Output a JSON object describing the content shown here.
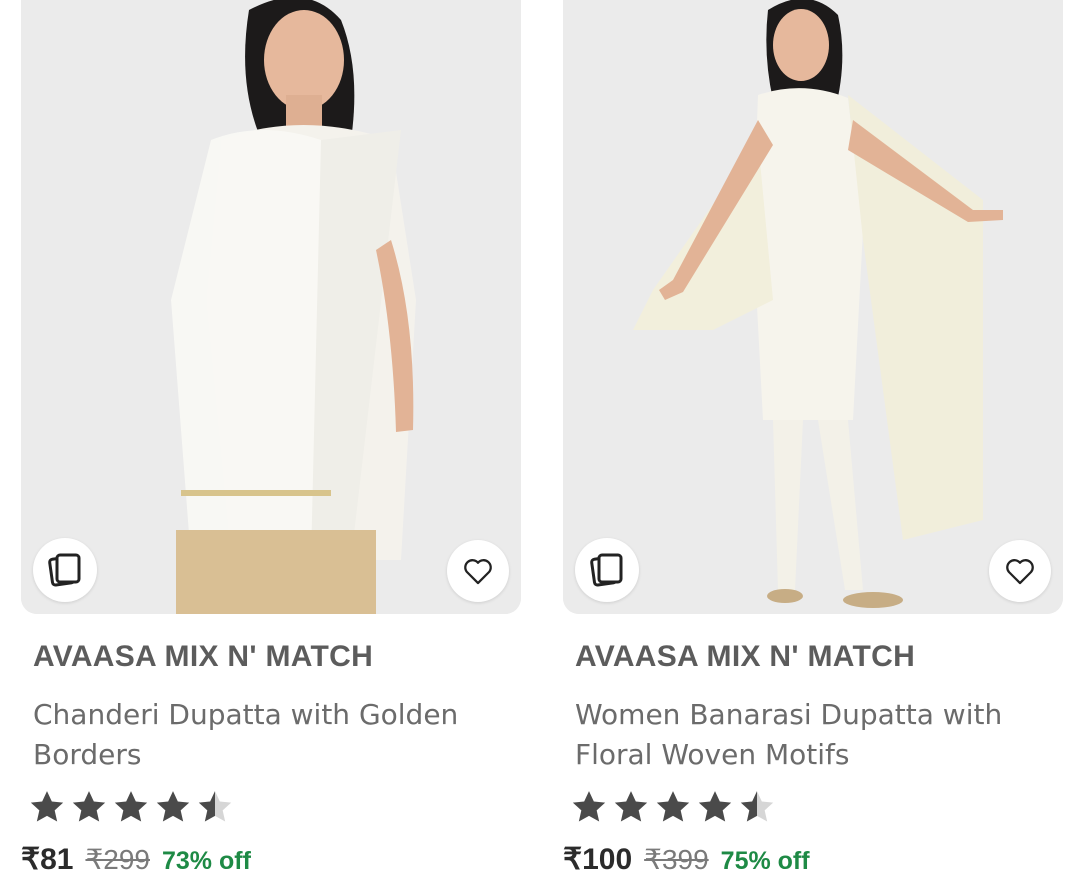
{
  "products": [
    {
      "brand": "AVAASA MIX N' MATCH",
      "title": "Chanderi Dupatta with Golden Borders",
      "rating": 4.5,
      "price": "₹81",
      "mrp": "₹299",
      "discount": "73% off",
      "image_desc_icon": "model-wearing-white-dupatta",
      "similar_icon": "similar-products-icon",
      "wishlist_icon": "heart-icon"
    },
    {
      "brand": "AVAASA MIX N' MATCH",
      "title": "Women Banarasi Dupatta with Floral Woven Motifs",
      "rating": 4.5,
      "price": "₹100",
      "mrp": "₹399",
      "discount": "75% off",
      "image_desc_icon": "model-wearing-cream-dupatta",
      "similar_icon": "similar-products-icon",
      "wishlist_icon": "heart-icon"
    }
  ],
  "colors": {
    "discount": "#1e8a45",
    "star": "#4a4a4a",
    "star_empty": "#d6d6d6"
  }
}
